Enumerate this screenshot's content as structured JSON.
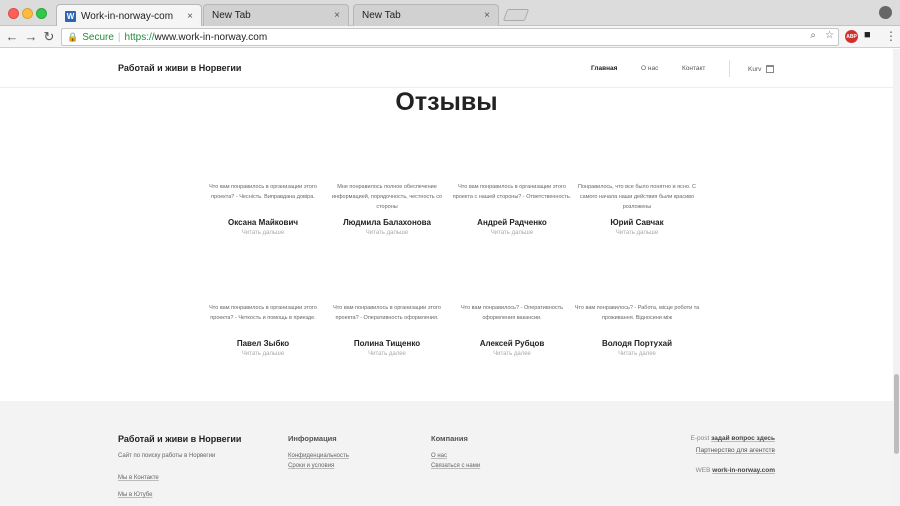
{
  "browser": {
    "tabs": [
      {
        "label": "Work-in-norway-com",
        "favicon": "W",
        "close": "×"
      },
      {
        "label": "New Tab",
        "close": "×"
      },
      {
        "label": "New Tab",
        "close": "×"
      }
    ],
    "url_secure_label": "Secure",
    "url_separator": "|",
    "url_scheme": "https://",
    "url_host": "www.work-in-norway.com",
    "ext_abp": "ABP"
  },
  "header": {
    "brand": "Работай и живи в Норвегии",
    "nav": [
      "Главная",
      "О нас",
      "Контакт"
    ],
    "cart_label": "Kurv"
  },
  "section": {
    "title": "Отзывы"
  },
  "reviews": [
    {
      "quote": "Что вам понравилось в организации этого проекта? - Чесність. Виправдана довіра.",
      "name": "Оксана Майкович",
      "more": "Читать дальше"
    },
    {
      "quote": "Мне понравилось полное обеспечение информацией, порядочность, честность со стороны",
      "name": "Людмила Балахонова",
      "more": "Читать дальше"
    },
    {
      "quote": "Что вам понравилось в организации этого проекта с нашей стороны? - Ответственность.",
      "name": "Андрей Радченко",
      "more": "Читать дальше"
    },
    {
      "quote": "Понравилось, что все было понятно и ясно. С самого начала наши действия были красиво розложены",
      "name": "Юрий Савчак",
      "more": "Читать дальше"
    },
    {
      "quote": "Что вам понравилось в организации этого проекта? - Четкость и помощь в приезде.",
      "name": "Павел Зыбко",
      "more": "Читать дальше"
    },
    {
      "quote": "Что вам понравилось в организации этого проекта? - Оперативность оформления.",
      "name": "Полина Тищенко",
      "more": "Читать далее"
    },
    {
      "quote": "Что вам понравилось? - Оперативность оформления вакансии.",
      "name": "Алексей Рубцов",
      "more": "Читать далее"
    },
    {
      "quote": "Что вам понравилось? - Работа, місце роботи та проживання. Відносини між",
      "name": "Володя Портухай",
      "more": "Читать далее"
    }
  ],
  "footer": {
    "brand": "Работай и живи в Норвегии",
    "description": "Сайт по поиску работы в Норвегии",
    "social": [
      "Мы в Контакте",
      "Мы в Ютубе"
    ],
    "info_heading": "Информация",
    "info_links": [
      "Конфиденциальность",
      "Сроки и условия"
    ],
    "company_heading": "Компания",
    "company_links": [
      "О нас",
      "Связаться с нами"
    ],
    "epost_label": "E-post",
    "epost_link": "задай вопрос здесь",
    "partner_link": "Партнерство для агентств",
    "web_label": "WEB",
    "web_value": "work-in-norway.com"
  }
}
